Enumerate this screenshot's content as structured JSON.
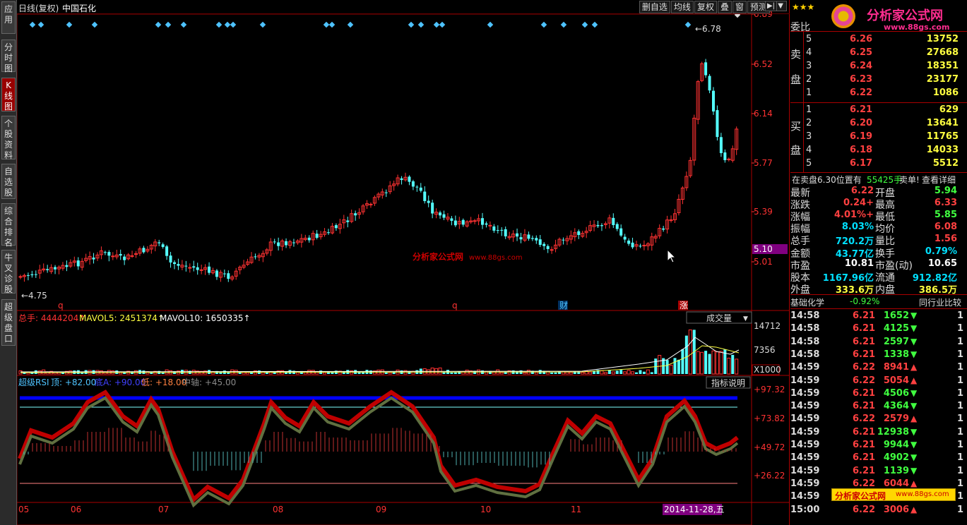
{
  "header": {
    "period": "日线(复权)",
    "stock": "中国石化",
    "buttons": [
      "删自选",
      "均线",
      "复权",
      "叠",
      "窗",
      "预测"
    ]
  },
  "left_tabs": [
    {
      "label": "应用",
      "active": false
    },
    {
      "label": "分时图",
      "active": false
    },
    {
      "label": "K线图",
      "active": true
    },
    {
      "label": "个股资料",
      "active": false
    },
    {
      "label": "自选股",
      "active": false
    },
    {
      "label": "综合排名",
      "active": false
    },
    {
      "label": "牛叉诊股",
      "active": false
    },
    {
      "label": "超级盘口",
      "active": false
    }
  ],
  "price_axis": {
    "labels": [
      "6.89",
      "6.52",
      "6.14",
      "5.77",
      "5.39",
      "5.01"
    ],
    "current": "5.10"
  },
  "markers": {
    "high": "6.78",
    "low": "4.75",
    "events": [
      "q",
      "q",
      "财",
      "涨"
    ]
  },
  "volume": {
    "title": "总手: 4444204↑",
    "ma5": "MAVOL5: 2451374↑",
    "ma10": "MAVOL10: 1650335↑",
    "dropdown": "成交量",
    "axis": [
      "14712",
      "7356"
    ],
    "unit": "X1000"
  },
  "rsi": {
    "title": "超级RSI",
    "top": "顶: +82.00",
    "bottom": "底A: +90.00",
    "low": "低: +18.00",
    "mid": "中轴: +45.00",
    "button": "指标说明",
    "axis": [
      "+97.32",
      "+73.82",
      "+49.72",
      "+26.22"
    ]
  },
  "date_axis": {
    "months": [
      "05",
      "06",
      "07",
      "08",
      "09",
      "10",
      "11"
    ],
    "cursor_date": "2014-11-28,五"
  },
  "watermark": {
    "text": "分析家公式网",
    "url": "www.88gs.com"
  },
  "order_book": {
    "header": "委比",
    "sell_label": "卖盘",
    "buy_label": "买盘",
    "sell": [
      {
        "n": "5",
        "price": "6.26",
        "vol": "13752"
      },
      {
        "n": "4",
        "price": "6.25",
        "vol": "27668"
      },
      {
        "n": "3",
        "price": "6.24",
        "vol": "18351"
      },
      {
        "n": "2",
        "price": "6.23",
        "vol": "23177"
      },
      {
        "n": "1",
        "price": "6.22",
        "vol": "1086"
      }
    ],
    "buy": [
      {
        "n": "1",
        "price": "6.21",
        "vol": "629"
      },
      {
        "n": "2",
        "price": "6.20",
        "vol": "13641"
      },
      {
        "n": "3",
        "price": "6.19",
        "vol": "11765"
      },
      {
        "n": "4",
        "price": "6.18",
        "vol": "14033"
      },
      {
        "n": "5",
        "price": "6.17",
        "vol": "5512"
      }
    ]
  },
  "notice": {
    "text": "在卖盘6.30位置有",
    "vol": "55425手",
    "tail": "卖单!",
    "link": "查看详细"
  },
  "stats": [
    {
      "l1": "最新",
      "v1": "6.22",
      "c1": "#ff4040",
      "l2": "开盘",
      "v2": "5.94",
      "c2": "#40ff40"
    },
    {
      "l1": "涨跌",
      "v1": "+0.24",
      "c1": "#ff4040",
      "l2": "最高",
      "v2": "6.33",
      "c2": "#ff4040"
    },
    {
      "l1": "涨幅",
      "v1": "+4.01%",
      "c1": "#ff4040",
      "l2": "最低",
      "v2": "5.85",
      "c2": "#40ff40"
    },
    {
      "l1": "振幅",
      "v1": "8.03%",
      "c1": "#00e0ff",
      "l2": "均价",
      "v2": "6.08",
      "c2": "#ff4040"
    },
    {
      "l1": "总手",
      "v1": "720.2万",
      "c1": "#00e0ff",
      "l2": "量比",
      "v2": "1.56",
      "c2": "#ff4040"
    },
    {
      "l1": "金额",
      "v1": "43.77亿",
      "c1": "#00e0ff",
      "l2": "换手",
      "v2": "0.79%",
      "c2": "#00e0ff"
    },
    {
      "l1": "市盈",
      "v1": "10.81",
      "c1": "#ffffff",
      "l2": "市盈(动)",
      "v2": "10.65",
      "c2": "#ffffff"
    },
    {
      "l1": "股本",
      "v1": "1167.96亿",
      "c1": "#00e0ff",
      "l2": "流通",
      "v2": "912.82亿",
      "c2": "#00e0ff"
    },
    {
      "l1": "外盘",
      "v1": "333.6万",
      "c1": "#ffff40",
      "l2": "内盘",
      "v2": "386.5万",
      "c2": "#ffff40"
    }
  ],
  "sector": {
    "name": "基础化学",
    "change": "-0.92%",
    "link": "同行业比较"
  },
  "ticks": [
    {
      "t": "14:58",
      "p": "6.21",
      "v": "1652",
      "up": false
    },
    {
      "t": "14:58",
      "p": "6.21",
      "v": "4125",
      "up": false
    },
    {
      "t": "14:58",
      "p": "6.21",
      "v": "2597",
      "up": false
    },
    {
      "t": "14:58",
      "p": "6.21",
      "v": "1338",
      "up": false
    },
    {
      "t": "14:59",
      "p": "6.22",
      "v": "8941",
      "up": true
    },
    {
      "t": "14:59",
      "p": "6.22",
      "v": "5054",
      "up": true
    },
    {
      "t": "14:59",
      "p": "6.21",
      "v": "4506",
      "up": false
    },
    {
      "t": "14:59",
      "p": "6.21",
      "v": "4364",
      "up": false
    },
    {
      "t": "14:59",
      "p": "6.22",
      "v": "2579",
      "up": true
    },
    {
      "t": "14:59",
      "p": "6.21",
      "v": "12938",
      "up": false
    },
    {
      "t": "14:59",
      "p": "6.21",
      "v": "9944",
      "up": false
    },
    {
      "t": "14:59",
      "p": "6.21",
      "v": "4902",
      "up": false
    },
    {
      "t": "14:59",
      "p": "6.21",
      "v": "1139",
      "up": false
    },
    {
      "t": "14:59",
      "p": "6.22",
      "v": "6044",
      "up": true
    },
    {
      "t": "14:59",
      "p": "6.21",
      "v": "",
      "up": false
    },
    {
      "t": "15:00",
      "p": "6.22",
      "v": "3006",
      "up": true
    }
  ],
  "tick_suffix": "1",
  "logo": {
    "text": "分析家公式网",
    "url": "www.88gs.com"
  }
}
